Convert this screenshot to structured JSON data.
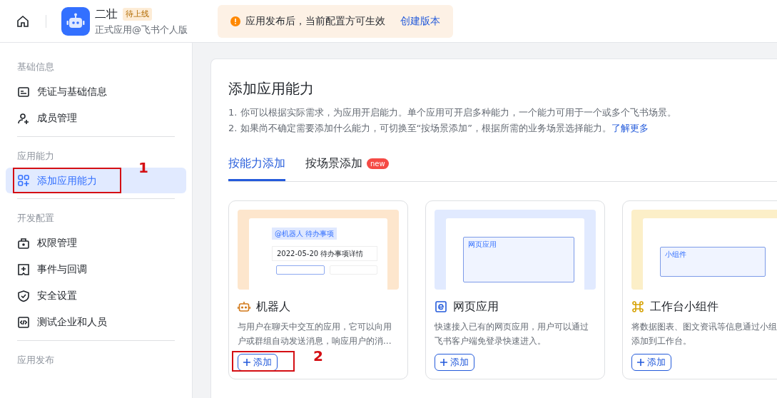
{
  "header": {
    "app_name": "二壮",
    "status_badge": "待上线",
    "app_subtitle": "正式应用@飞书个人版",
    "notice": {
      "text": "应用发布后，当前配置方可生效",
      "link": "创建版本"
    }
  },
  "sidebar": {
    "sections": [
      {
        "title": "基础信息",
        "items": [
          {
            "label": "凭证与基础信息",
            "selected": false
          },
          {
            "label": "成员管理",
            "selected": false
          }
        ]
      },
      {
        "title": "应用能力",
        "items": [
          {
            "label": "添加应用能力",
            "selected": true,
            "annotation": "1"
          }
        ]
      },
      {
        "title": "开发配置",
        "items": [
          {
            "label": "权限管理",
            "selected": false
          },
          {
            "label": "事件与回调",
            "selected": false
          },
          {
            "label": "安全设置",
            "selected": false
          },
          {
            "label": "测试企业和人员",
            "selected": false
          }
        ]
      },
      {
        "title": "应用发布"
      }
    ]
  },
  "main": {
    "title": "添加应用能力",
    "notes": [
      "1. 你可以根据实际需求，为应用开启能力。单个应用可开启多种能力，一个能力可用于一个或多个飞书场景。",
      "2. 如果尚不确定需要添加什么能力，可切换至“按场景添加”，根据所需的业务场景选择能力。"
    ],
    "learn_more_link": "了解更多",
    "tabs": [
      {
        "label": "按能力添加",
        "selected": true
      },
      {
        "label": "按场景添加",
        "selected": false,
        "badge": "new"
      }
    ],
    "cards": [
      {
        "kind": "bot",
        "title": "机器人",
        "description": [
          "与用户在聊天中交互的应用，它可以向用",
          "户或群组自动发送消息，响应用户的消..."
        ],
        "button": "添加",
        "annotation": "2",
        "preview_texts": [
          "@机器人 待办事项",
          "2022-05-20 待办事项详情"
        ]
      },
      {
        "kind": "web",
        "title": "网页应用",
        "description": [
          "快速接入已有的网页应用，用户可以通过",
          "飞书客户端免登录快速进入。"
        ],
        "button": "添加",
        "preview_texts": [
          "网页应用"
        ]
      },
      {
        "kind": "widget",
        "title": "工作台小组件",
        "description": [
          "将数据图表、图文资讯等信息通过小组",
          "添加到工作台。"
        ],
        "button": "添加",
        "preview_texts": [
          "小组件"
        ]
      }
    ]
  }
}
